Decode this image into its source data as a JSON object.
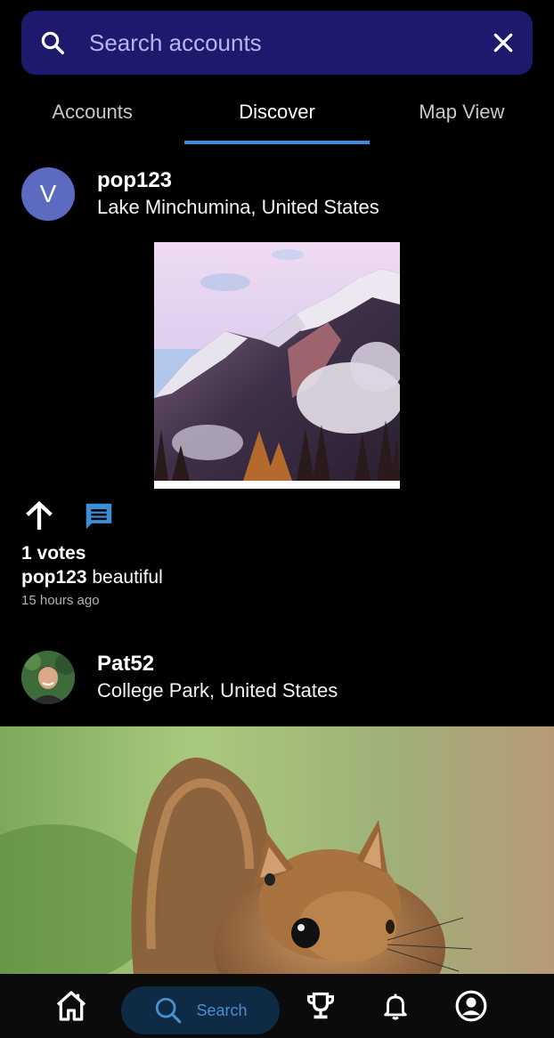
{
  "search": {
    "placeholder": "Search accounts",
    "icon": "search-icon",
    "clear_icon": "close-icon"
  },
  "tabs": [
    {
      "label": "Accounts",
      "active": false
    },
    {
      "label": "Discover",
      "active": true
    },
    {
      "label": "Map View",
      "active": false
    }
  ],
  "posts": [
    {
      "avatar_letter": "V",
      "avatar_color": "#5c6bc0",
      "username": "pop123",
      "location": "Lake Minchumina, United States",
      "image": "snowy-mountain-photo",
      "votes": "1 votes",
      "caption_user": "pop123",
      "caption_text": "beautiful",
      "time": "15 hours ago"
    },
    {
      "avatar": "profile-photo",
      "username": "Pat52",
      "location": "College Park, United States",
      "image": "squirrel-photo"
    }
  ],
  "bottom_nav": {
    "search_label": "Search",
    "items": [
      "home-icon",
      "search-icon",
      "trophy-icon",
      "bell-icon",
      "account-icon"
    ]
  },
  "colors": {
    "search_bar_bg": "#1d1a6e",
    "tab_indicator": "#3a8fd8",
    "comment_icon": "#3a8fd8",
    "nav_search_bg": "#0f2a44"
  }
}
